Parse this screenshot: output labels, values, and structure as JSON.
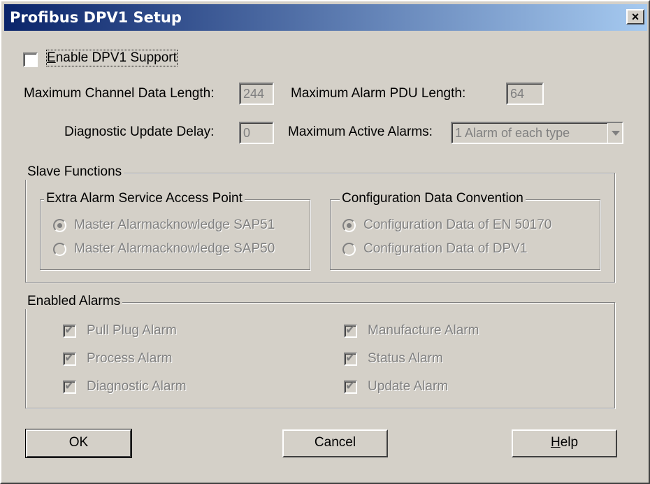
{
  "window": {
    "title": "Profibus DPV1 Setup",
    "close_glyph": "×"
  },
  "enable": {
    "label_prefix": "E",
    "label_rest": "nable DPV1 Support",
    "checked": false
  },
  "fields": {
    "max_channel_label": "Maximum Channel Data Length:",
    "max_channel_value": "244",
    "max_alarm_pdu_label": "Maximum Alarm PDU Length:",
    "max_alarm_pdu_value": "64",
    "diag_delay_label": "Diagnostic Update Delay:",
    "diag_delay_value": "0",
    "max_active_label": "Maximum Active Alarms:",
    "max_active_value": "1 Alarm of each type"
  },
  "slave": {
    "title": "Slave Functions",
    "sap": {
      "title": "Extra Alarm Service Access Point",
      "options": [
        "Master Alarmacknowledge SAP51",
        "Master Alarmacknowledge SAP50"
      ],
      "selected": 0
    },
    "config": {
      "title": "Configuration Data Convention",
      "options": [
        "Configuration Data of EN 50170",
        "Configuration Data of DPV1"
      ],
      "selected": 0
    }
  },
  "alarms": {
    "title": "Enabled Alarms",
    "items": [
      "Pull Plug Alarm",
      "Process Alarm",
      "Diagnostic Alarm",
      "Manufacture Alarm",
      "Status Alarm",
      "Update Alarm"
    ],
    "check_glyph": "✔"
  },
  "buttons": {
    "ok": "OK",
    "cancel": "Cancel",
    "help_prefix": "H",
    "help_rest": "elp"
  }
}
